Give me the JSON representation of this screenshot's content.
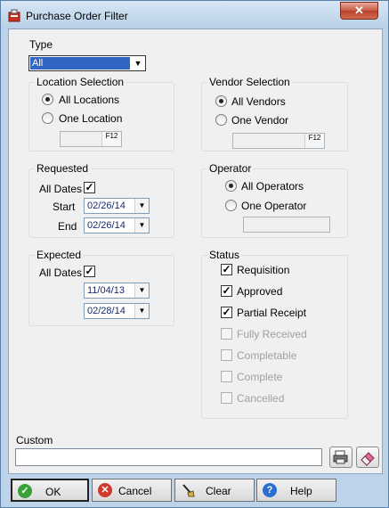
{
  "window": {
    "title": "Purchase Order Filter",
    "close_label": "✕"
  },
  "type": {
    "label": "Type",
    "value": "All"
  },
  "location_selection": {
    "title": "Location Selection",
    "all_label": "All Locations",
    "one_label": "One Location",
    "selected": "all",
    "lookup_key": "F12"
  },
  "vendor_selection": {
    "title": "Vendor Selection",
    "all_label": "All Vendors",
    "one_label": "One Vendor",
    "selected": "all",
    "lookup_key": "F12"
  },
  "requested": {
    "title": "Requested",
    "all_dates_label": "All Dates",
    "all_dates_checked": true,
    "start_label": "Start",
    "start_date": "02/26/14",
    "end_label": "End",
    "end_date": "02/26/14"
  },
  "operator": {
    "title": "Operator",
    "all_label": "All Operators",
    "one_label": "One Operator",
    "selected": "all"
  },
  "expected": {
    "title": "Expected",
    "all_dates_label": "All Dates",
    "all_dates_checked": true,
    "start_date": "11/04/13",
    "end_date": "02/28/14"
  },
  "status": {
    "title": "Status",
    "items": [
      {
        "label": "Requisition",
        "checked": true,
        "enabled": true
      },
      {
        "label": "Approved",
        "checked": true,
        "enabled": true
      },
      {
        "label": "Partial Receipt",
        "checked": true,
        "enabled": true
      },
      {
        "label": "Fully Received",
        "checked": false,
        "enabled": false
      },
      {
        "label": "Completable",
        "checked": false,
        "enabled": false
      },
      {
        "label": "Complete",
        "checked": false,
        "enabled": false
      },
      {
        "label": "Cancelled",
        "checked": false,
        "enabled": false
      }
    ]
  },
  "custom": {
    "label": "Custom",
    "value": ""
  },
  "buttons": {
    "ok": "OK",
    "cancel": "Cancel",
    "clear": "Clear",
    "help": "Help"
  },
  "colors": {
    "selection": "#3166c4",
    "ok_icon": "#3aa03a",
    "cancel_icon": "#d03a2a",
    "help_icon": "#2a6fd0"
  }
}
